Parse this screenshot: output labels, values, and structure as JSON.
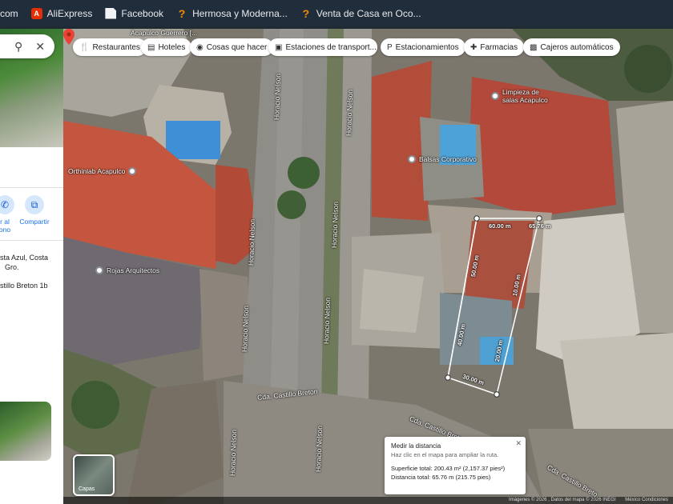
{
  "bookmarks": [
    {
      "label": "com",
      "icon": "none"
    },
    {
      "label": "AliExpress",
      "icon": "aliexpress-icon"
    },
    {
      "label": "Facebook",
      "icon": "document-icon"
    },
    {
      "label": "Hermosa y Moderna...",
      "icon": "pin-icon"
    },
    {
      "label": "Venta de Casa en Oco...",
      "icon": "pin-icon"
    }
  ],
  "panel": {
    "search_icon": "search-icon",
    "close_icon": "close-icon",
    "action_phone_label": "r al\nono",
    "action_share_label": "Compartir",
    "address_line1": "sta Azul, Costa",
    "address_line2": "Gro.",
    "address_line3": "stillo Breton 1b"
  },
  "chips": [
    {
      "label": "Restaurantes",
      "icon": "restaurant-icon"
    },
    {
      "label": "Hoteles",
      "icon": "hotel-icon"
    },
    {
      "label": "Cosas que hacer",
      "icon": "camera-icon"
    },
    {
      "label": "Estaciones de transport...",
      "icon": "transit-icon"
    },
    {
      "label": "Estacionamientos",
      "icon": "parking-icon"
    },
    {
      "label": "Farmacias",
      "icon": "pharmacy-icon"
    },
    {
      "label": "Cajeros automáticos",
      "icon": "atm-icon"
    }
  ],
  "map": {
    "streets": {
      "top_cut": "Acapulco Guerrero [...",
      "horacio": "Horacio Nelson",
      "castillo": "Cda. Castillo Breton",
      "castillo_partial": "Cda. Castillo Breto"
    },
    "pois": {
      "limpieza": "Limpieza de\nsalas Acapulco",
      "balsas": "Balsas Corporativo",
      "orthinlab": "Orthinlab Acapulco",
      "rojas": "Rojas Arquitectos"
    },
    "measurements": {
      "top_a": "60.00 m",
      "top_b": "65.76 m",
      "left_upper": "50.00 m",
      "right": "10.00 m",
      "left_lower": "40.00 m",
      "inner": "20.00 m",
      "bottom": "30.00 m"
    },
    "layers_label": "Capas",
    "footer_attribution": "Imágenes © 2026 , Datos del mapa © 2026 INEGI",
    "footer_terms": "México   Condiciones"
  },
  "measure_card": {
    "title": "Medir la distancia",
    "subtitle": "Haz clic en el mapa para ampliar la ruta.",
    "area": "Superficie total: 200.43 m² (2,157.37 pies²)",
    "distance": "Distancia total: 65.76 m (215.75 pies)",
    "close_icon": "close-icon"
  },
  "colors": {
    "bookmark_bar": "#202e3c",
    "marker": "#ea4335",
    "measure_line": "#ffffff"
  }
}
